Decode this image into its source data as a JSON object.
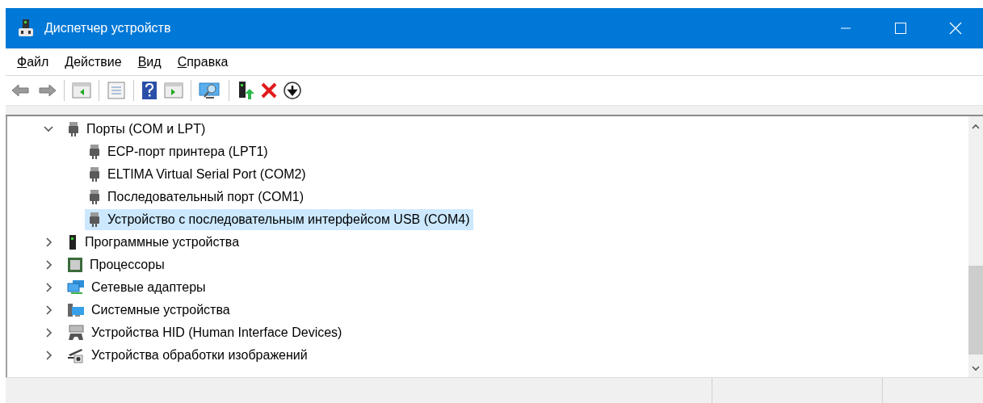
{
  "window": {
    "title": "Диспетчер устройств"
  },
  "menu": [
    {
      "label": "Файл"
    },
    {
      "label": "Действие"
    },
    {
      "label": "Вид"
    },
    {
      "label": "Справка"
    }
  ],
  "tree": [
    {
      "label": "Порты (COM и LPT)",
      "expanded": true,
      "selected": false,
      "children": [
        {
          "label": "ECP-порт принтера (LPT1)",
          "selected": false
        },
        {
          "label": "ELTIMA Virtual Serial Port (COM2)",
          "selected": false
        },
        {
          "label": "Последовательный порт (COM1)",
          "selected": false
        },
        {
          "label": "Устройство с последовательным интерфейсом USB (COM4)",
          "selected": true
        }
      ]
    },
    {
      "label": "Программные устройства",
      "expanded": false,
      "selected": false
    },
    {
      "label": "Процессоры",
      "expanded": false,
      "selected": false
    },
    {
      "label": "Сетевые адаптеры",
      "expanded": false,
      "selected": false
    },
    {
      "label": "Системные устройства",
      "expanded": false,
      "selected": false
    },
    {
      "label": "Устройства HID (Human Interface Devices)",
      "expanded": false,
      "selected": false
    },
    {
      "label": "Устройства обработки изображений",
      "expanded": false,
      "selected": false
    }
  ]
}
